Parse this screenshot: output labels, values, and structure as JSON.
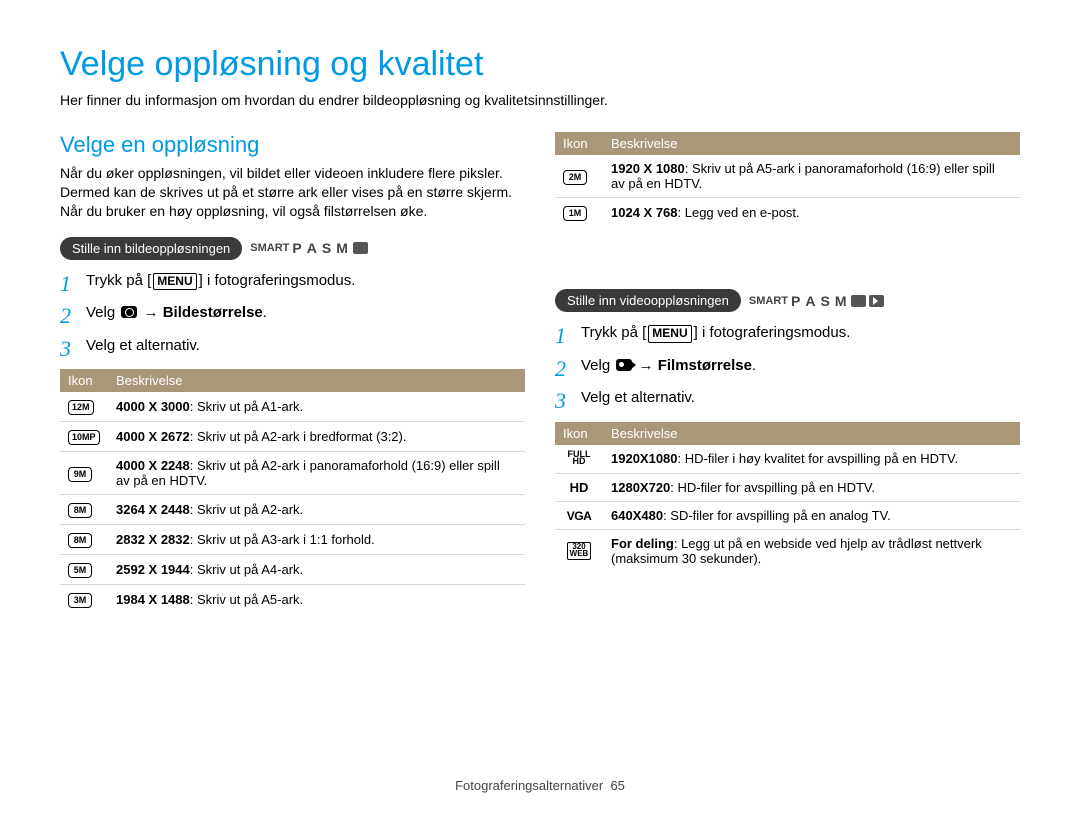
{
  "title": "Velge oppløsning og kvalitet",
  "subtitle": "Her finner du informasjon om hvordan du endrer bildeoppløsning og kvalitetsinnstillinger.",
  "section": {
    "heading": "Velge en oppløsning",
    "desc": "Når du øker oppløsningen, vil bildet eller videoen inkludere flere piksler. Dermed kan de skrives ut på et større ark eller vises på en større skjerm. Når du bruker en høy oppløsning, vil også filstørrelsen øke."
  },
  "image": {
    "pill": "Stille inn bildeoppløsningen",
    "modes": "SMART P A S M ★",
    "steps": {
      "s1a": "Trykk på [",
      "s1_btn": "MENU",
      "s1b": "] i fotograferingsmodus.",
      "s2a": "Velg ",
      "s2b": " → ",
      "s2c": "Bildestørrelse",
      "s2d": ".",
      "s3": "Velg et alternativ."
    },
    "table": {
      "h1": "Ikon",
      "h2": "Beskrivelse",
      "rows": [
        {
          "ikon": "12M",
          "res": "4000 X 3000",
          "desc": ": Skriv ut på A1-ark."
        },
        {
          "ikon": "10MP",
          "res": "4000 X 2672",
          "desc": ": Skriv ut på A2-ark i bredformat (3:2)."
        },
        {
          "ikon": "9M",
          "res": "4000 X 2248",
          "desc": ": Skriv ut på A2-ark i panoramaforhold (16:9) eller spill av på en HDTV."
        },
        {
          "ikon": "8M",
          "res": "3264 X 2448",
          "desc": ": Skriv ut på A2-ark."
        },
        {
          "ikon": "8M",
          "res": "2832 X 2832",
          "desc": ": Skriv ut på A3-ark i 1:1 forhold."
        },
        {
          "ikon": "5M",
          "res": "2592 X 1944",
          "desc": ": Skriv ut på A4-ark."
        },
        {
          "ikon": "3M",
          "res": "1984 X 1488",
          "desc": ": Skriv ut på A5-ark."
        }
      ]
    }
  },
  "image_cont": {
    "rows": [
      {
        "ikon": "2M",
        "res": "1920 X 1080",
        "desc": ": Skriv ut på A5-ark i panoramaforhold (16:9) eller spill av på en HDTV."
      },
      {
        "ikon": "1M",
        "res": "1024 X 768",
        "desc": ": Legg ved en e-post."
      }
    ]
  },
  "video": {
    "pill": "Stille inn videooppløsningen",
    "modes": "SMART P A S M ★ ▶",
    "steps": {
      "s1a": "Trykk på [",
      "s1_btn": "MENU",
      "s1b": "] i fotograferingsmodus.",
      "s2a": "Velg ",
      "s2b": " → ",
      "s2c": "Filmstørrelse",
      "s2d": ".",
      "s3": "Velg et alternativ."
    },
    "table": {
      "h1": "Ikon",
      "h2": "Beskrivelse",
      "rows": [
        {
          "ikon": "FULLHD",
          "res": "1920X1080",
          "desc": ": HD-filer i høy kvalitet for avspilling på en HDTV."
        },
        {
          "ikon": "HD",
          "res": "1280X720",
          "desc": ": HD-filer for avspilling på en HDTV."
        },
        {
          "ikon": "VGA",
          "res": "640X480",
          "desc": ": SD-filer for avspilling på en analog TV."
        },
        {
          "ikon": "320WEB",
          "res": "For deling",
          "desc": ": Legg ut på en webside ved hjelp av trådløst nettverk (maksimum 30 sekunder)."
        }
      ]
    }
  },
  "footer": {
    "section": "Fotograferingsalternativer",
    "page": "65"
  }
}
